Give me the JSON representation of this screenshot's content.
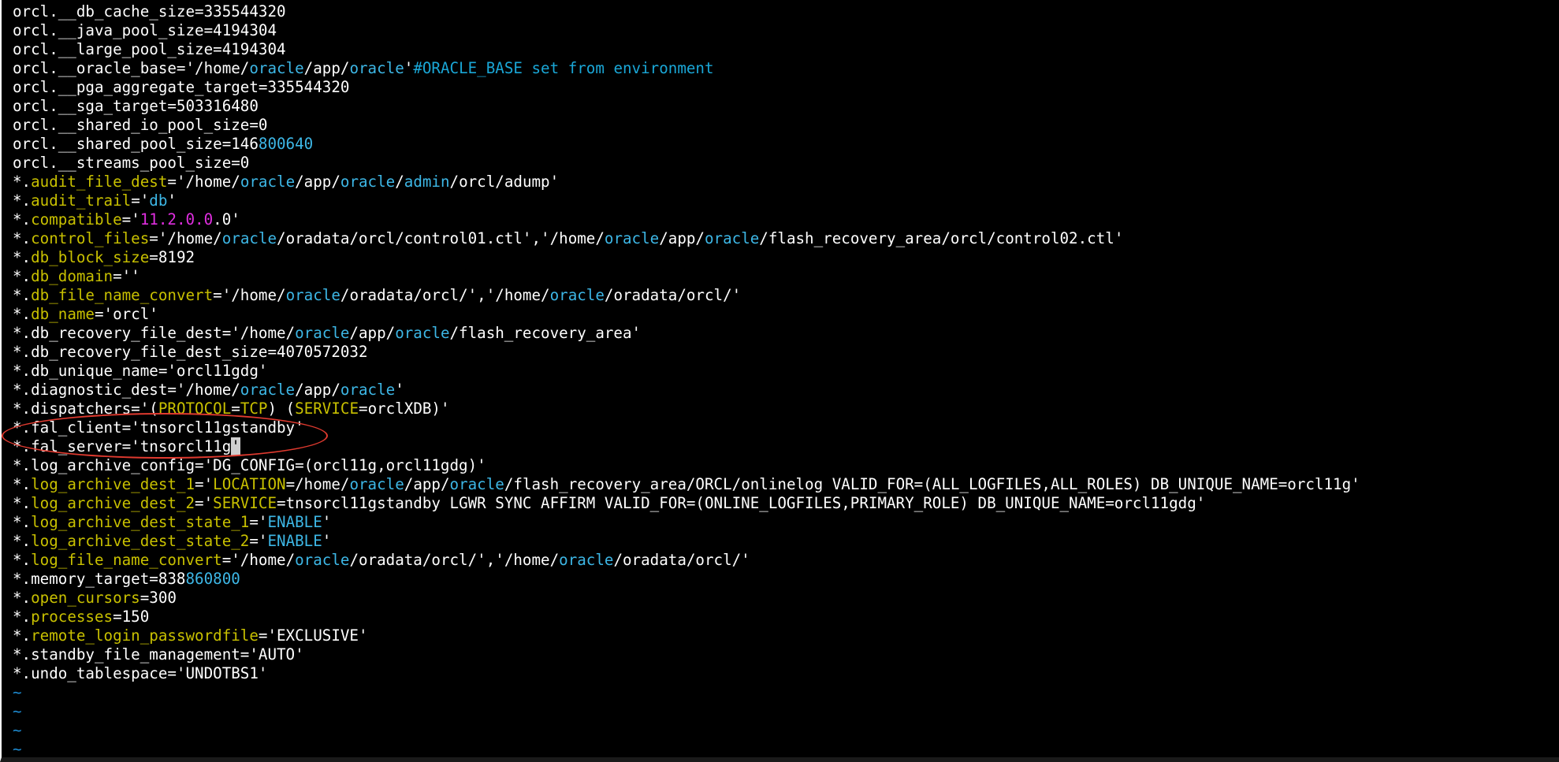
{
  "colors": {
    "background": "#000000",
    "text": "#ffffff",
    "parameter": "#c8c000",
    "path_keyword": "#3db7e6",
    "comment": "#1aa7d7",
    "number": "#e02ee0",
    "tilde": "#1e8bd1",
    "annotation_ellipse": "#e03a2f"
  },
  "editor": {
    "lines": [
      [
        {
          "t": "orcl.__db_cache_size=335544320"
        }
      ],
      [
        {
          "t": "orcl.__java_pool_size=4194304"
        }
      ],
      [
        {
          "t": "orcl.__large_pool_size=4194304"
        }
      ],
      [
        {
          "t": "orcl.__oracle_base='/home/"
        },
        {
          "t": "oracle",
          "c": "path_keyword"
        },
        {
          "t": "/app/"
        },
        {
          "t": "oracle",
          "c": "path_keyword"
        },
        {
          "t": "'"
        },
        {
          "t": "#ORACLE_BASE set from environment",
          "c": "comment"
        }
      ],
      [
        {
          "t": "orcl.__pga_aggregate_target=335544320"
        }
      ],
      [
        {
          "t": "orcl.__sga_target=503316480"
        }
      ],
      [
        {
          "t": "orcl.__shared_io_pool_size=0"
        }
      ],
      [
        {
          "t": "orcl.__shared_pool_size=146"
        },
        {
          "t": "800640",
          "c": "path_keyword"
        }
      ],
      [
        {
          "t": "orcl.__streams_pool_size=0"
        }
      ],
      [
        {
          "t": "*."
        },
        {
          "t": "audit_file_dest",
          "c": "parameter"
        },
        {
          "t": "='/home/"
        },
        {
          "t": "oracle",
          "c": "path_keyword"
        },
        {
          "t": "/app/"
        },
        {
          "t": "oracle",
          "c": "path_keyword"
        },
        {
          "t": "/"
        },
        {
          "t": "admin",
          "c": "path_keyword"
        },
        {
          "t": "/orcl/adump'"
        }
      ],
      [
        {
          "t": "*."
        },
        {
          "t": "audit_trail",
          "c": "parameter"
        },
        {
          "t": "='"
        },
        {
          "t": "db",
          "c": "path_keyword"
        },
        {
          "t": "'"
        }
      ],
      [
        {
          "t": "*."
        },
        {
          "t": "compatible",
          "c": "parameter"
        },
        {
          "t": "='"
        },
        {
          "t": "11.2.0.0",
          "c": "number"
        },
        {
          "t": ".0'"
        }
      ],
      [
        {
          "t": "*."
        },
        {
          "t": "control_files",
          "c": "parameter"
        },
        {
          "t": "='/home/"
        },
        {
          "t": "oracle",
          "c": "path_keyword"
        },
        {
          "t": "/oradata/orcl/control01.ctl','/home/"
        },
        {
          "t": "oracle",
          "c": "path_keyword"
        },
        {
          "t": "/app/"
        },
        {
          "t": "oracle",
          "c": "path_keyword"
        },
        {
          "t": "/flash_recovery_area/orcl/control02.ctl'"
        }
      ],
      [
        {
          "t": "*."
        },
        {
          "t": "db_block_size",
          "c": "parameter"
        },
        {
          "t": "=8192"
        }
      ],
      [
        {
          "t": "*."
        },
        {
          "t": "db_domain",
          "c": "parameter"
        },
        {
          "t": "=''"
        }
      ],
      [
        {
          "t": "*."
        },
        {
          "t": "db_file_name_convert",
          "c": "parameter"
        },
        {
          "t": "='/home/"
        },
        {
          "t": "oracle",
          "c": "path_keyword"
        },
        {
          "t": "/oradata/orcl/','/home/"
        },
        {
          "t": "oracle",
          "c": "path_keyword"
        },
        {
          "t": "/oradata/orcl/'"
        }
      ],
      [
        {
          "t": "*."
        },
        {
          "t": "db_name",
          "c": "parameter"
        },
        {
          "t": "='orcl'"
        }
      ],
      [
        {
          "t": "*.db_recovery_file_dest='/home/"
        },
        {
          "t": "oracle",
          "c": "path_keyword"
        },
        {
          "t": "/app/"
        },
        {
          "t": "oracle",
          "c": "path_keyword"
        },
        {
          "t": "/flash_recovery_area'"
        }
      ],
      [
        {
          "t": "*.db_recovery_file_dest_size=4070572032"
        }
      ],
      [
        {
          "t": "*.db_unique_name='orcl11gdg'"
        }
      ],
      [
        {
          "t": "*.diagnostic_dest='/home/"
        },
        {
          "t": "oracle",
          "c": "path_keyword"
        },
        {
          "t": "/app/"
        },
        {
          "t": "oracle",
          "c": "path_keyword"
        },
        {
          "t": "'"
        }
      ],
      [
        {
          "t": "*.dispatchers='("
        },
        {
          "t": "PROTOCOL",
          "c": "parameter"
        },
        {
          "t": "="
        },
        {
          "t": "TCP",
          "c": "parameter"
        },
        {
          "t": ") ("
        },
        {
          "t": "SERVICE",
          "c": "parameter"
        },
        {
          "t": "=orclXDB)'"
        }
      ],
      [
        {
          "t": "*.fal_client='tnsorcl11gstandby'"
        }
      ],
      [
        {
          "t": "*.fal_server='tnsorcl11g"
        },
        {
          "t": "'",
          "c": "cursor"
        }
      ],
      [
        {
          "t": "*.log_archive_config='DG_CONFIG=(orcl11g,orcl11gdg)'"
        }
      ],
      [
        {
          "t": "*."
        },
        {
          "t": "log_archive_dest_1",
          "c": "parameter"
        },
        {
          "t": "='"
        },
        {
          "t": "LOCATION",
          "c": "parameter"
        },
        {
          "t": "=/home/"
        },
        {
          "t": "oracle",
          "c": "path_keyword"
        },
        {
          "t": "/app/"
        },
        {
          "t": "oracle",
          "c": "path_keyword"
        },
        {
          "t": "/flash_recovery_area/ORCL/onlinelog VALID_FOR=(ALL_LOGFILES,ALL_ROLES) DB_UNIQUE_NAME=orcl11g'"
        }
      ],
      [
        {
          "t": "*."
        },
        {
          "t": "log_archive_dest_2",
          "c": "parameter"
        },
        {
          "t": "='"
        },
        {
          "t": "SERVICE",
          "c": "parameter"
        },
        {
          "t": "=tnsorcl11gstandby LGWR SYNC AFFIRM VALID_FOR=(ONLINE_LOGFILES,PRIMARY_ROLE) DB_UNIQUE_NAME=orcl11gdg'"
        }
      ],
      [
        {
          "t": "*."
        },
        {
          "t": "log_archive_dest_state_1",
          "c": "parameter"
        },
        {
          "t": "='"
        },
        {
          "t": "ENABLE",
          "c": "path_keyword"
        },
        {
          "t": "'"
        }
      ],
      [
        {
          "t": "*."
        },
        {
          "t": "log_archive_dest_state_2",
          "c": "parameter"
        },
        {
          "t": "='"
        },
        {
          "t": "ENABLE",
          "c": "path_keyword"
        },
        {
          "t": "'"
        }
      ],
      [
        {
          "t": "*."
        },
        {
          "t": "log_file_name_convert",
          "c": "parameter"
        },
        {
          "t": "='/home/"
        },
        {
          "t": "oracle",
          "c": "path_keyword"
        },
        {
          "t": "/oradata/orcl/','/home/"
        },
        {
          "t": "oracle",
          "c": "path_keyword"
        },
        {
          "t": "/oradata/orcl/'"
        }
      ],
      [
        {
          "t": "*.memory_target=838"
        },
        {
          "t": "860800",
          "c": "path_keyword"
        }
      ],
      [
        {
          "t": "*."
        },
        {
          "t": "open_cursors",
          "c": "parameter"
        },
        {
          "t": "=300"
        }
      ],
      [
        {
          "t": "*."
        },
        {
          "t": "processes",
          "c": "parameter"
        },
        {
          "t": "=150"
        }
      ],
      [
        {
          "t": "*."
        },
        {
          "t": "remote_login_passwordfile",
          "c": "parameter"
        },
        {
          "t": "='EXCLUSIVE'"
        }
      ],
      [
        {
          "t": "*.standby_file_management='AUTO'"
        }
      ],
      [
        {
          "t": "*.undo_tablespace='UNDOTBS1'"
        }
      ]
    ],
    "empty_line_markers": [
      "~",
      "~",
      "~",
      "~"
    ]
  }
}
